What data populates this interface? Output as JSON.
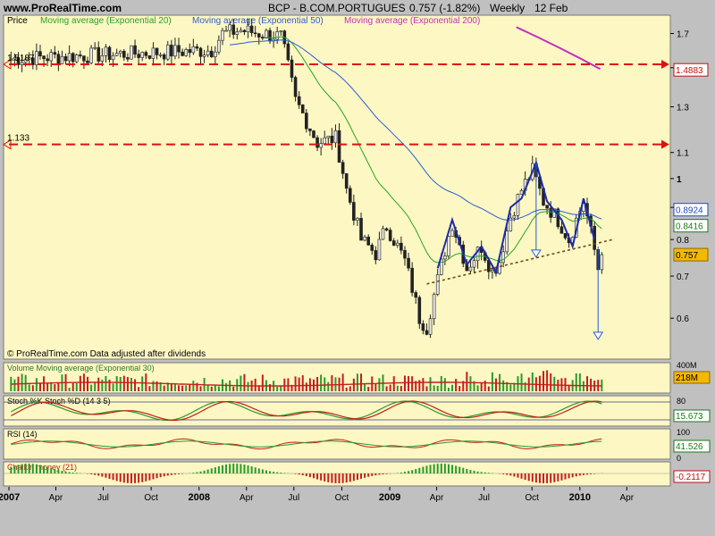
{
  "site": "www.ProRealTime.com",
  "header": {
    "instrument": "BCP - B.COM.PORTUGUES",
    "quote": "0.757 (-1.82%)",
    "period": "Weekly",
    "date": "12 Feb"
  },
  "credit": "© ProRealTime.com  Data adjusted after dividends",
  "colors": {
    "panel_bg": "#fdf7c3",
    "frame_bg": "#c0c0c0",
    "up": "#2a9a2a",
    "down": "#c41e1e",
    "ema20": "#27a527",
    "ema50": "#2a5cd6",
    "ema200": "#c030c0",
    "pattern": "#1c2aa8",
    "resistance": "#e01010",
    "trend": "#6b4a1a"
  },
  "chart_data": [
    {
      "type": "candlestick",
      "panel": "price",
      "label": "Price",
      "legend": [
        "Moving average (Exponential 20)",
        "Moving average (Exponential 50)",
        "Moving average (Exponential 200)"
      ],
      "ylim": [
        0.52,
        1.8
      ],
      "log_scale": true,
      "y_ticks": [
        "1.7",
        "1.5",
        "1.3",
        "1.1",
        "1",
        "0.9",
        "0.8",
        "0.7",
        "0.6"
      ],
      "x_ticks": [
        "2007",
        "Apr",
        "Jul",
        "Oct",
        "2008",
        "Apr",
        "Jul",
        "Oct",
        "2009",
        "Apr",
        "Jul",
        "Oct",
        "2010",
        "Apr"
      ],
      "start": "2007-01-05",
      "last_close": 0.757,
      "close_anchors": [
        [
          "2007-01-05",
          1.55
        ],
        [
          "2008-01-25",
          1.6
        ],
        [
          "2008-02-15",
          1.7
        ],
        [
          "2008-03-21",
          1.72
        ],
        [
          "2008-06-06",
          1.68
        ],
        [
          "2008-07-04",
          1.33
        ],
        [
          "2008-08-15",
          1.14
        ],
        [
          "2008-09-19",
          1.16
        ],
        [
          "2008-10-10",
          0.96
        ],
        [
          "2008-11-07",
          0.8
        ],
        [
          "2008-12-05",
          0.76
        ],
        [
          "2008-12-26",
          0.84
        ],
        [
          "2009-01-30",
          0.74
        ],
        [
          "2009-02-27",
          0.6
        ],
        [
          "2009-03-13",
          0.58
        ],
        [
          "2009-04-03",
          0.69
        ],
        [
          "2009-05-01",
          0.85
        ],
        [
          "2009-05-29",
          0.72
        ],
        [
          "2009-06-26",
          0.78
        ],
        [
          "2009-07-17",
          0.71
        ],
        [
          "2009-07-31",
          0.74
        ],
        [
          "2009-08-21",
          0.87
        ],
        [
          "2009-09-11",
          0.96
        ],
        [
          "2009-10-02",
          1.03
        ],
        [
          "2009-10-23",
          0.92
        ],
        [
          "2009-11-20",
          0.86
        ],
        [
          "2009-12-11",
          0.8
        ],
        [
          "2010-01-08",
          0.92
        ],
        [
          "2010-01-22",
          0.82
        ],
        [
          "2010-02-05",
          0.72
        ],
        [
          "2010-02-12",
          0.757
        ]
      ],
      "ema200_last": 1.4883,
      "ema50_last": 0.8924,
      "ema20_last": 0.8416,
      "resistance_levels": [
        {
          "value": 1.5187,
          "label": "1.5187"
        },
        {
          "value": 1.133,
          "label": "1.133"
        }
      ],
      "right_labels": [
        "1.4883",
        "0.8924",
        "0.8416",
        "0.757"
      ],
      "trendline": [
        [
          "2009-03-13",
          0.68
        ],
        [
          "2010-03-05",
          0.8
        ]
      ],
      "pattern_zigzag": [
        [
          "2009-04-03",
          0.72
        ],
        [
          "2009-05-01",
          0.86
        ],
        [
          "2009-05-29",
          0.73
        ],
        [
          "2009-06-26",
          0.78
        ],
        [
          "2009-07-24",
          0.71
        ],
        [
          "2009-08-21",
          0.9
        ],
        [
          "2009-09-11",
          0.93
        ],
        [
          "2009-10-09",
          1.06
        ],
        [
          "2009-10-30",
          0.92
        ],
        [
          "2009-11-27",
          0.86
        ],
        [
          "2009-12-18",
          0.78
        ],
        [
          "2010-01-08",
          0.93
        ],
        [
          "2010-01-29",
          0.8
        ]
      ],
      "target_arrows": [
        {
          "date": "2009-10-09",
          "from": 1.06,
          "to": 0.77
        },
        {
          "date": "2010-02-05",
          "from": 0.78,
          "to": 0.57
        }
      ]
    },
    {
      "type": "bar",
      "panel": "volume",
      "label": "Volume Moving average (Exponential 30)",
      "y_ticks": [
        "400M"
      ],
      "right_label": "218M"
    },
    {
      "type": "line",
      "panel": "stochastic",
      "label": "Stoch %K Stoch %D (14 3 5)",
      "y_ticks": [
        "80",
        "20"
      ],
      "right_label": "15.673"
    },
    {
      "type": "line",
      "panel": "rsi",
      "label": "RSI (14)",
      "y_ticks": [
        "100",
        "0"
      ],
      "right_label": "41.526"
    },
    {
      "type": "bar",
      "panel": "chaikin",
      "label": "Chaikin money (21)",
      "right_label": "-0.2117"
    }
  ]
}
